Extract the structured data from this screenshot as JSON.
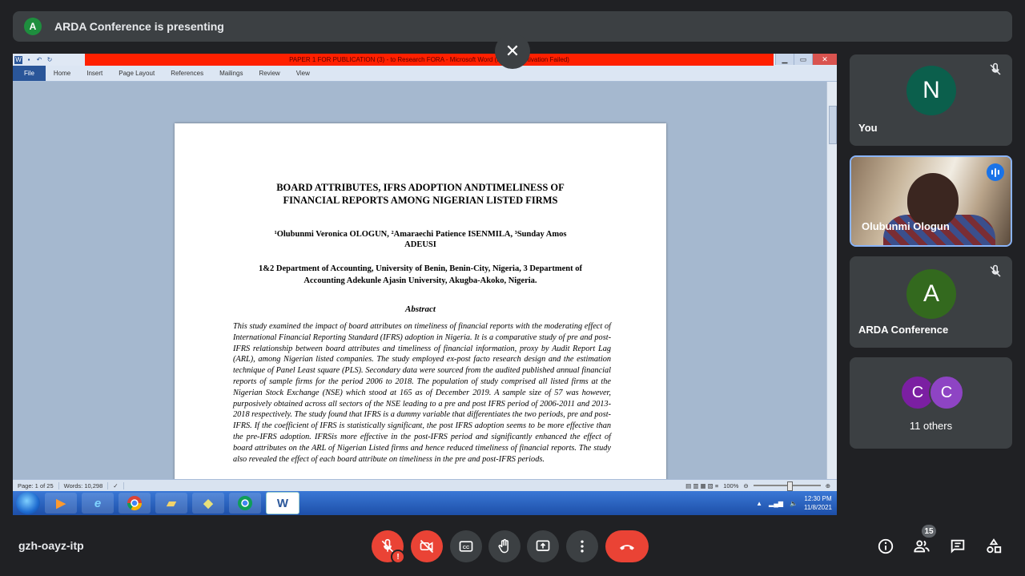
{
  "presenter_banner": {
    "avatar_initial": "A",
    "text": "ARDA Conference is presenting"
  },
  "word": {
    "window_title": "PAPER 1 FOR PUBLICATION (3) - to Research FORA  -  Microsoft Word (Product Activation Failed)",
    "tabs": [
      "File",
      "Home",
      "Insert",
      "Page Layout",
      "References",
      "Mailings",
      "Review",
      "View"
    ],
    "document": {
      "title_line1": "BOARD ATTRIBUTES, IFRS ADOPTION ANDTIMELINESS OF",
      "title_line2": "FINANCIAL REPORTS AMONG NIGERIAN LISTED FIRMS",
      "authors_line1": "¹Olubunmi Veronica OLOGUN, ²Amaraechi Patience ISENMILA, ³Sunday Amos",
      "authors_line2": "ADEUSI",
      "affil_line1": "1&2 Department of Accounting, University of Benin, Benin-City, Nigeria, 3 Department of",
      "affil_line2": "Accounting Adekunle Ajasin University, Akugba-Akoko, Nigeria.",
      "abstract_heading": "Abstract",
      "abstract_text": "This study examined the impact of board attributes on timeliness of financial reports with the moderating effect of International Financial Reporting Standard (IFRS) adoption in Nigeria. It is a comparative study of pre and post-IFRS relationship between board attributes and timeliness of financial information, proxy by Audit Report Lag (ARL), among Nigerian listed companies. The study employed ex-post facto research design and the estimation technique of Panel Least square (PLS). Secondary data were sourced from the audited published annual financial reports of sample firms for the period 2006 to 2018. The population of study comprised all listed firms at the Nigerian Stock Exchange (NSE) which stood at 165 as of December 2019. A sample size of 57 was however, purposively obtained across all sectors of the NSE leading to a pre and post IFRS period of 2006-2011 and 2013-2018 respectively. The study found that IFRS is a dummy variable that differentiates the two periods, pre and post-IFRS. If the coefficient of IFRS is statistically significant, the post IFRS adoption seems to be more effective than the pre-IFRS adoption. IFRSis more effective in the post-IFRS period and significantly enhanced the effect of board attributes on the ARL of Nigerian Listed firms and hence reduced timeliness of financial reports. The study also revealed the effect of each board attribute on timeliness in the pre and post-IFRS periods."
    },
    "status": {
      "page": "Page: 1 of 25",
      "words": "Words: 10,298",
      "zoom": "100%"
    },
    "taskbar": {
      "time": "12:30 PM",
      "date": "11/8/2021",
      "word_label": "W"
    }
  },
  "participants": {
    "you": {
      "initial": "N",
      "name": "You",
      "avatar_color": "#0b5f4c"
    },
    "speaker": {
      "name": "Olubunmi Ologun"
    },
    "arda": {
      "initial": "A",
      "name": "ARDA Conference",
      "avatar_color": "#33691e"
    },
    "others": {
      "initial1": "C",
      "initial2": "C",
      "label": "11 others",
      "color1": "#7b1fa2",
      "color2": "#8e44c4"
    }
  },
  "meeting": {
    "code": "gzh-oayz-itp",
    "participant_count": "15"
  }
}
